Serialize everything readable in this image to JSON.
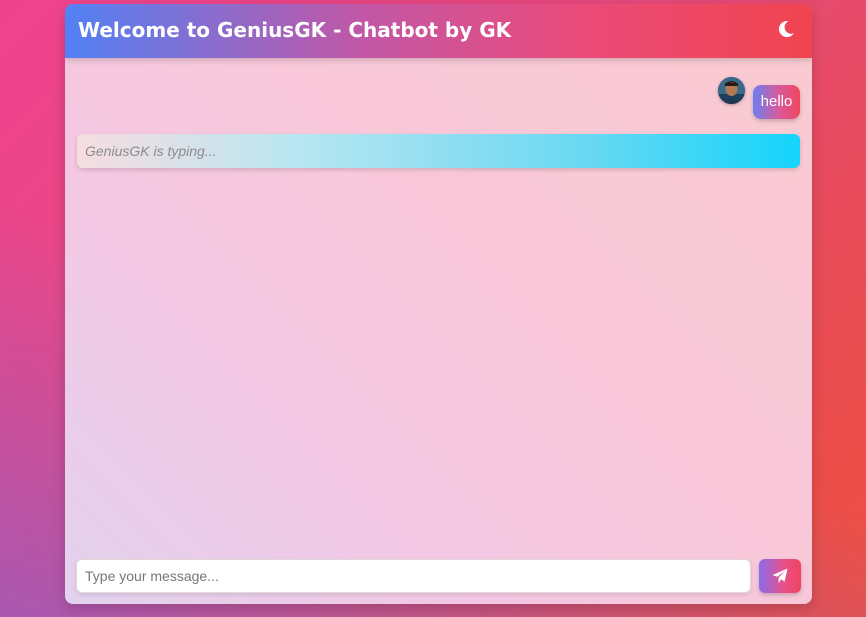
{
  "header": {
    "title": "Welcome to GeniusGK - Chatbot by GK",
    "theme_toggle_icon": "moon-icon"
  },
  "messages": [
    {
      "sender": "user",
      "text": "hello",
      "avatar_icon": "user-avatar"
    }
  ],
  "typing_indicator": {
    "text": "GeniusGK is typing..."
  },
  "composer": {
    "input_value": "",
    "placeholder": "Type your message...",
    "send_icon": "paper-plane-icon"
  },
  "colors": {
    "header_gradient_start": "#5281f5",
    "header_gradient_end": "#f0444f",
    "typing_gradient_end": "#14d4fb",
    "accent_pink": "#e8508a"
  }
}
